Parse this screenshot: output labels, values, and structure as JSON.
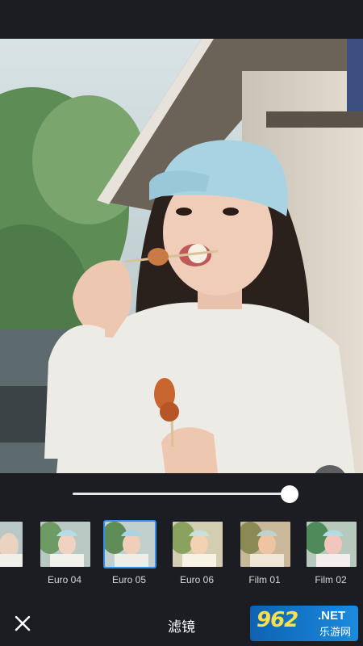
{
  "editor": {
    "photo_description_icon": "photo-preview",
    "compare_icon": "compare-split-icon"
  },
  "slider": {
    "value_fraction": 0.99
  },
  "filters": [
    {
      "label": "",
      "partial": true
    },
    {
      "label": "Euro 04",
      "selected": false
    },
    {
      "label": "Euro 05",
      "selected": true
    },
    {
      "label": "Euro 06",
      "selected": false
    },
    {
      "label": "Film 01",
      "selected": false
    },
    {
      "label": "Film 02",
      "selected": false
    }
  ],
  "bottom_bar": {
    "close_icon": "close-icon",
    "title": "滤镜"
  },
  "watermark": {
    "number": "962",
    "net": ".NET",
    "sub": "乐游网"
  },
  "colors": {
    "background": "#1b1d22",
    "accent_selected": "#2f8ef0"
  }
}
